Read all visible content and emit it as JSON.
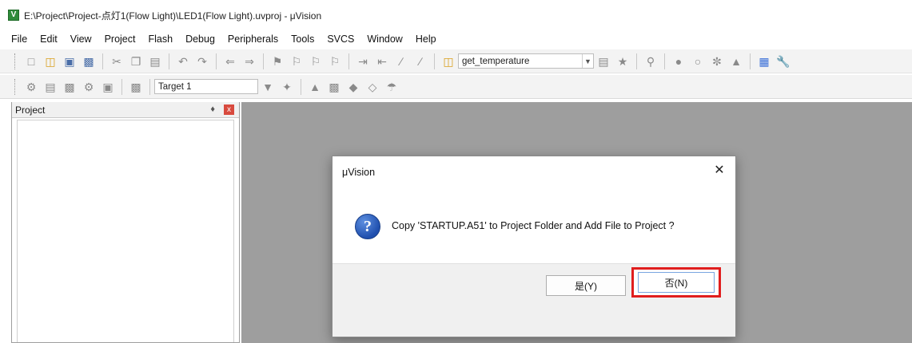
{
  "window": {
    "title": "E:\\Project\\Project-点灯1(Flow Light)\\LED1(Flow Light).uvproj - μVision",
    "app_icon_letter": "V"
  },
  "menu": [
    "File",
    "Edit",
    "View",
    "Project",
    "Flash",
    "Debug",
    "Peripherals",
    "Tools",
    "SVCS",
    "Window",
    "Help"
  ],
  "toolbar1": {
    "function_combo_value": "get_temperature"
  },
  "toolbar2": {
    "target_combo_value": "Target 1"
  },
  "project_panel": {
    "title": "Project",
    "pin_glyph": "ᵖ",
    "close_glyph": "x"
  },
  "dialog": {
    "title": "μVision",
    "close_glyph": "✕",
    "icon_glyph": "?",
    "message": "Copy 'STARTUP.A51' to Project Folder and Add File to Project ?",
    "yes_label": "是(Y)",
    "no_label": "否(N)",
    "highlight_color": "#e01e1e"
  }
}
